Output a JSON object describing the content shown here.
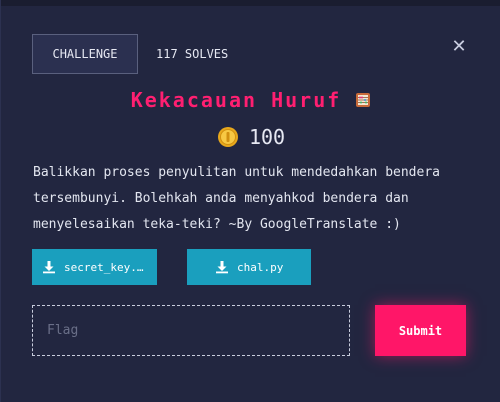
{
  "tabs": {
    "challenge_label": "CHALLENGE",
    "solves_label": "117 SOLVES"
  },
  "close_icon": "close-icon",
  "challenge": {
    "title": "Kekacauan Huruf",
    "title_icon": "abacus-icon",
    "points_icon": "coin-icon",
    "points": "100",
    "description": "Balikkan proses penyulitan untuk mendedahkan bendera tersembunyi. Bolehkah anda menyahkod bendera dan menyelesaikan teka-teki? ~By GoogleTranslate :)"
  },
  "files": [
    {
      "label": "secret_key.…",
      "icon": "download-icon"
    },
    {
      "label": "chal.py",
      "icon": "download-icon"
    }
  ],
  "flag_form": {
    "placeholder": "Flag",
    "value": "",
    "submit_label": "Submit"
  },
  "colors": {
    "background": "#222640",
    "accent_pink": "#ff1668",
    "file_button": "#1a9fbe",
    "text": "#e6e8f2"
  }
}
